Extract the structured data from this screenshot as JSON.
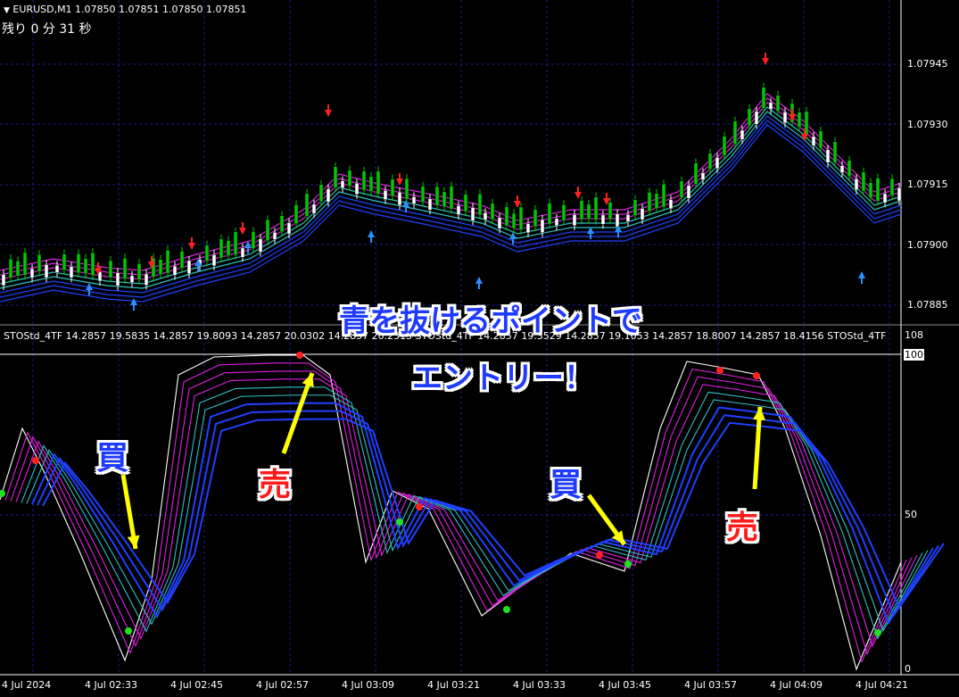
{
  "header": {
    "symbol_line": "EURUSD,M1  1.07850 1.07851 1.07850 1.07851",
    "timer": "残り 0 分 31 秒"
  },
  "price_axis": [
    "1.07945",
    "1.07930",
    "1.07915",
    "1.07900",
    "1.07885"
  ],
  "indicator": {
    "title": "STOStd_4TF 14.2857 19.5835 14.2857 19.8093 14.2857 20.0302 14.2857 20.2313 STOStd_4TF 14.2857 19.3529 14.2857 19.1053 14.2857 18.8007 14.2857 18.4156  STOStd_4TF",
    "axis_labels": [
      "108",
      "100",
      "50",
      "0"
    ]
  },
  "time_axis": [
    "4 Jul 2024",
    "4 Jul 02:33",
    "4 Jul 02:45",
    "4 Jul 02:57",
    "4 Jul 03:09",
    "4 Jul 03:21",
    "4 Jul 03:33",
    "4 Jul 03:45",
    "4 Jul 03:57",
    "4 Jul 04:09",
    "4 Jul 04:21"
  ],
  "callouts": {
    "line1": "青を抜けるポイントで",
    "line2": "エントリー！",
    "buy1": "買",
    "sell1": "売",
    "buy2": "買",
    "sell2": "売"
  },
  "colors": {
    "background": "#000000",
    "grid": "#1b1b8a",
    "bull_candle": "#00c800",
    "bear_candle": "#ffffff",
    "ma_magenta": "#e020e0",
    "ma_teal": "#30c0c0",
    "ma_blue": "#2040ff",
    "arrow_up": "#2a90ff",
    "arrow_down": "#ff2020",
    "annotation_arrow": "#ffff00"
  }
}
